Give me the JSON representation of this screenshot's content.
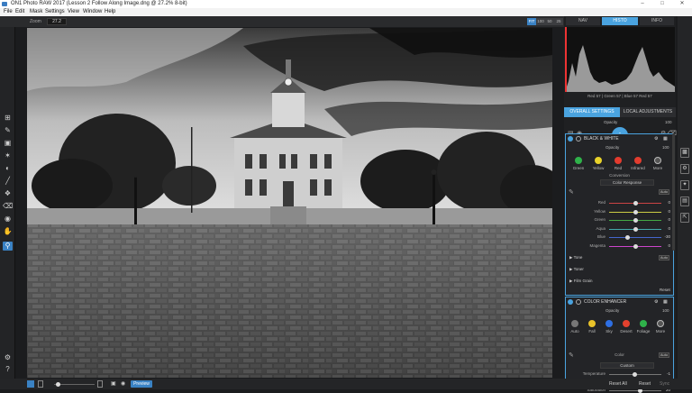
{
  "window": {
    "title": "ON1 Photo RAW 2017 (Lesson 2 Follow Along Image.dng @ 27.2% 8-bit)"
  },
  "menu": {
    "items": [
      "File",
      "Edit",
      "Mask",
      "Settings",
      "View",
      "Window",
      "Help"
    ]
  },
  "toolbar": {
    "zoom_label": "Zoom",
    "zoom_value": "27.2",
    "zoom_buttons": [
      "FIT",
      "100",
      "50",
      "25"
    ]
  },
  "bottom": {
    "preview_label": "Preview",
    "reset_all_label": "Reset All",
    "reset_label": "Reset",
    "sync_label": "Sync"
  },
  "panel": {
    "tabs": [
      "NAV",
      "HISTO",
      "INFO"
    ],
    "histo_info": "Red 57  | Green 57  | Blue 57  Red 57",
    "settings_tabs": [
      "OVERALL SETTINGS",
      "LOCAL ADJUSTMENTS"
    ],
    "opacity_label": "Opacity",
    "opacity_value": "100",
    "bw": {
      "title": "BLACK & WHITE",
      "opacity_label": "Opacity",
      "opacity_value": "100",
      "swatches": [
        {
          "label": "Green",
          "color": "#2fb24a"
        },
        {
          "label": "Yellow",
          "color": "#e8d22a"
        },
        {
          "label": "Red",
          "color": "#e33b2e"
        },
        {
          "label": "Infrared",
          "color": "#e23d2f"
        },
        {
          "label": "More",
          "color": "#555555"
        }
      ],
      "conversion_label": "Conversion",
      "conversion_value": "Color Response",
      "auto_label": "Auto",
      "channels": [
        {
          "label": "Red",
          "value": "0",
          "level": 0.5
        },
        {
          "label": "Yellow",
          "value": "0",
          "level": 0.5
        },
        {
          "label": "Green",
          "value": "0",
          "level": 0.5
        },
        {
          "label": "Aqua",
          "value": "0",
          "level": 0.5
        },
        {
          "label": "Blue",
          "value": "-30",
          "level": 0.35
        },
        {
          "label": "Magenta",
          "value": "0",
          "level": 0.5
        }
      ],
      "sections": [
        "Tone",
        "Toner",
        "Film Grain"
      ],
      "tone_auto": "Auto",
      "reset_label": "Reset"
    },
    "ce": {
      "title": "COLOR ENHANCER",
      "opacity_label": "Opacity",
      "opacity_value": "100",
      "swatches": [
        {
          "label": "Auto",
          "color": "#777777"
        },
        {
          "label": "Fall",
          "color": "#e8c22a"
        },
        {
          "label": "Sky",
          "color": "#2e6fe3"
        },
        {
          "label": "Desert",
          "color": "#e3412e"
        },
        {
          "label": "Foliage",
          "color": "#2fb24a"
        },
        {
          "label": "More",
          "color": "#555555"
        }
      ],
      "color_label": "Color",
      "color_value": "Custom",
      "auto_label": "Auto",
      "rows": [
        {
          "label": "Temperature",
          "value": "-1",
          "level": 0.49
        },
        {
          "label": "Tint",
          "value": "0",
          "level": 0.5
        },
        {
          "label": "Saturation",
          "value": "20",
          "level": 0.6
        }
      ]
    }
  },
  "colors": {
    "accent": "#4aa3df"
  },
  "left_tools": [
    "crop-icon",
    "brush-icon",
    "gradient-icon",
    "retouch-icon",
    "masking-icon",
    "line-mask-icon",
    "refine-icon",
    "perfect-eraser-icon",
    "clone-icon",
    "hand-icon",
    "zoom-icon"
  ],
  "right_tools": [
    "browse-icon",
    "develop-icon",
    "effects-icon",
    "layers-icon",
    "resize-icon"
  ]
}
